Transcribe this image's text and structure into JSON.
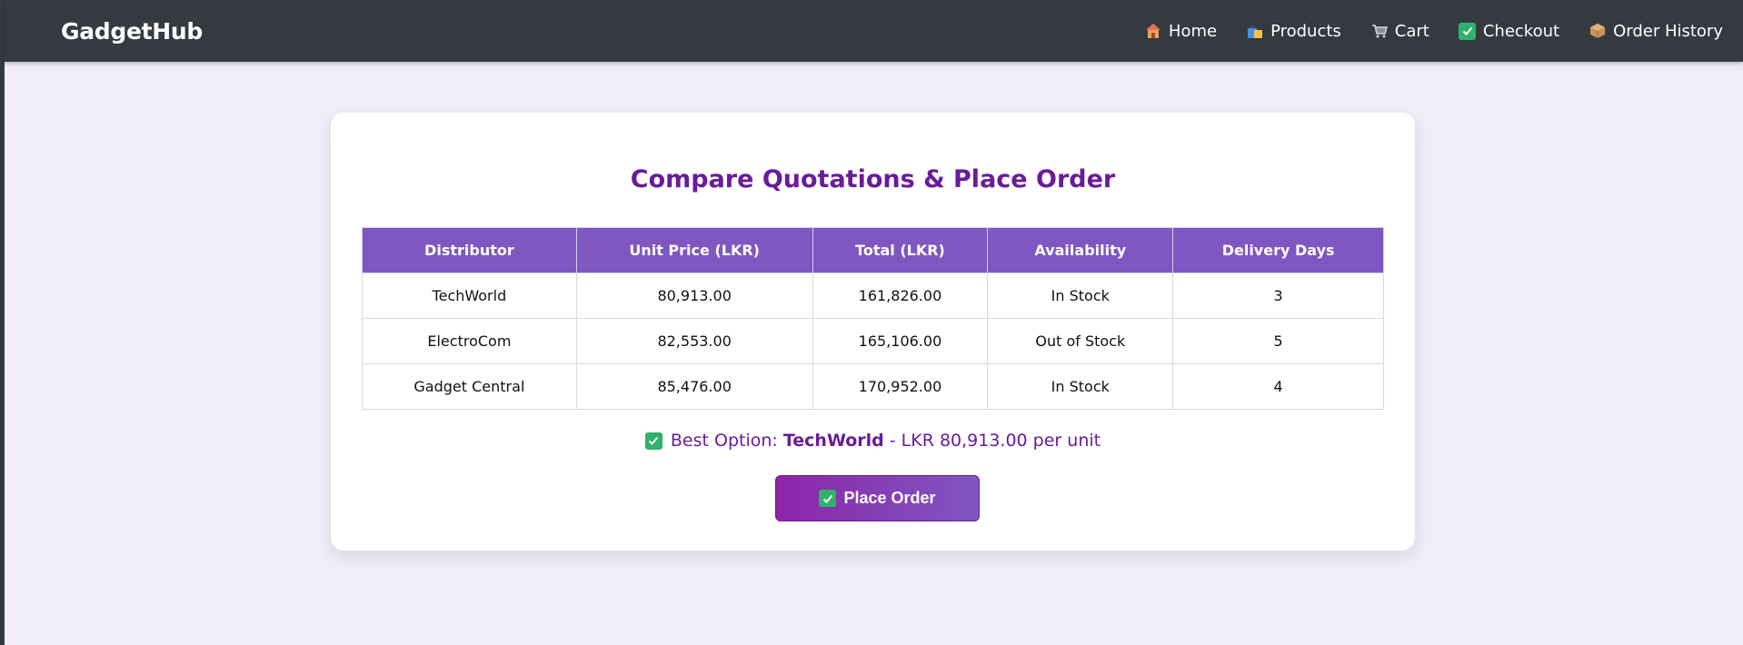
{
  "navbar": {
    "brand": "GadgetHub",
    "links": [
      {
        "label": "Home",
        "icon": "house-icon"
      },
      {
        "label": "Products",
        "icon": "shopping-bags-icon"
      },
      {
        "label": "Cart",
        "icon": "cart-icon"
      },
      {
        "label": "Checkout",
        "icon": "checkmark-icon"
      },
      {
        "label": "Order History",
        "icon": "package-icon"
      }
    ]
  },
  "page": {
    "title": "Compare Quotations & Place Order",
    "table": {
      "headers": [
        "Distributor",
        "Unit Price (LKR)",
        "Total (LKR)",
        "Availability",
        "Delivery Days"
      ],
      "rows": [
        [
          "TechWorld",
          "80,913.00",
          "161,826.00",
          "In Stock",
          "3"
        ],
        [
          "ElectroCom",
          "82,553.00",
          "165,106.00",
          "Out of Stock",
          "5"
        ],
        [
          "Gadget Central",
          "85,476.00",
          "170,952.00",
          "In Stock",
          "4"
        ]
      ]
    },
    "best_option": {
      "prefix": "Best Option:",
      "distributor": "TechWorld",
      "suffix": "- LKR 80,913.00 per unit"
    },
    "place_order_label": "Place Order"
  },
  "colors": {
    "navbar": "#343a40",
    "accent": "#6a1b9a",
    "table_header": "#7e57c2",
    "background": "#f1edf8",
    "check_green": "#2fb36b"
  }
}
